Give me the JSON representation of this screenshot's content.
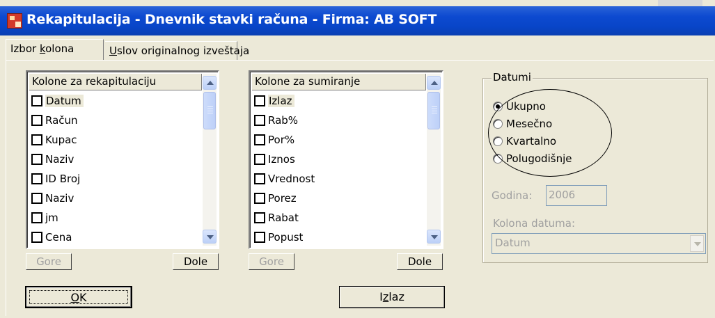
{
  "window": {
    "title": "Rekapitulacija - Dnevnik stavki računa - Firma: AB SOFT"
  },
  "tabs": [
    {
      "pre": "Izbor ",
      "key": "k",
      "post": "olona"
    },
    {
      "pre": "",
      "key": "U",
      "post": "slov originalnog izveštaja"
    }
  ],
  "left_list": {
    "header": "Kolone za rekapitulaciju",
    "items": [
      "Datum",
      "Račun",
      "Kupac",
      "Naziv",
      "ID Broj",
      "Naziv",
      "jm",
      "Cena"
    ],
    "up_label": "Gore",
    "down_label": "Dole"
  },
  "right_list": {
    "header": "Kolone za sumiranje",
    "items": [
      "Izlaz",
      "Rab%",
      "Por%",
      "Iznos",
      "Vrednost",
      "Porez",
      "Rabat",
      "Popust"
    ],
    "up_label": "Gore",
    "down_label": "Dole"
  },
  "dates": {
    "caption": "Datumi",
    "options": [
      "Ukupno",
      "Mesečno",
      "Kvartalno",
      "Polugodišnje"
    ],
    "selected": "Ukupno",
    "year_label": "Godina:",
    "year_value": "2006",
    "column_label": "Kolona datuma:",
    "column_value": "Datum"
  },
  "buttons": {
    "ok": {
      "key": "O",
      "post": "K"
    },
    "exit": {
      "pre": "I",
      "key": "z",
      "post": "laz"
    }
  }
}
